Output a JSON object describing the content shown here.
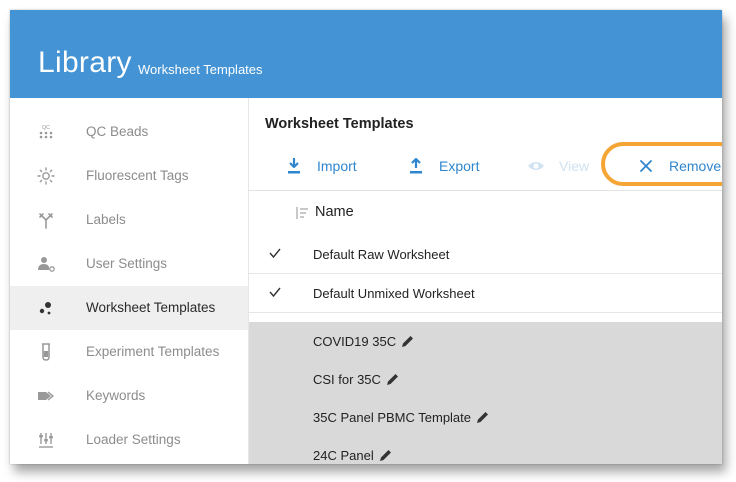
{
  "header": {
    "title": "Library",
    "subtitle": "Worksheet Templates"
  },
  "sidebar": {
    "items": [
      {
        "label": "QC Beads",
        "icon": "qc-beads-icon",
        "active": false
      },
      {
        "label": "Fluorescent Tags",
        "icon": "sun-icon",
        "active": false
      },
      {
        "label": "Labels",
        "icon": "antibody-icon",
        "active": false
      },
      {
        "label": "User Settings",
        "icon": "user-gear-icon",
        "active": false
      },
      {
        "label": "Worksheet Templates",
        "icon": "dots-icon",
        "active": true
      },
      {
        "label": "Experiment Templates",
        "icon": "tube-icon",
        "active": false
      },
      {
        "label": "Keywords",
        "icon": "tags-icon",
        "active": false
      },
      {
        "label": "Loader Settings",
        "icon": "sliders-icon",
        "active": false
      }
    ],
    "qc_icon_text": "QC"
  },
  "main": {
    "section_title": "Worksheet Templates",
    "toolbar": {
      "import_label": "Import",
      "export_label": "Export",
      "view_label": "View",
      "remove_label": "Remove"
    },
    "column_header": "Name",
    "rows": [
      {
        "label": "Default Raw Worksheet",
        "checked": true,
        "editable": false
      },
      {
        "label": "Default Unmixed Worksheet",
        "checked": true,
        "editable": false
      },
      {
        "label": "COVID19 35C",
        "checked": false,
        "editable": true
      },
      {
        "label": "CSI for 35C",
        "checked": false,
        "editable": true
      },
      {
        "label": "35C Panel PBMC Template",
        "checked": false,
        "editable": true
      },
      {
        "label": "24C Panel",
        "checked": false,
        "editable": true
      }
    ]
  },
  "colors": {
    "header_blue": "#4393d5",
    "accent_blue": "#2f86cf",
    "highlight_orange": "#f4a533",
    "row_gray": "#d9d9d9"
  }
}
